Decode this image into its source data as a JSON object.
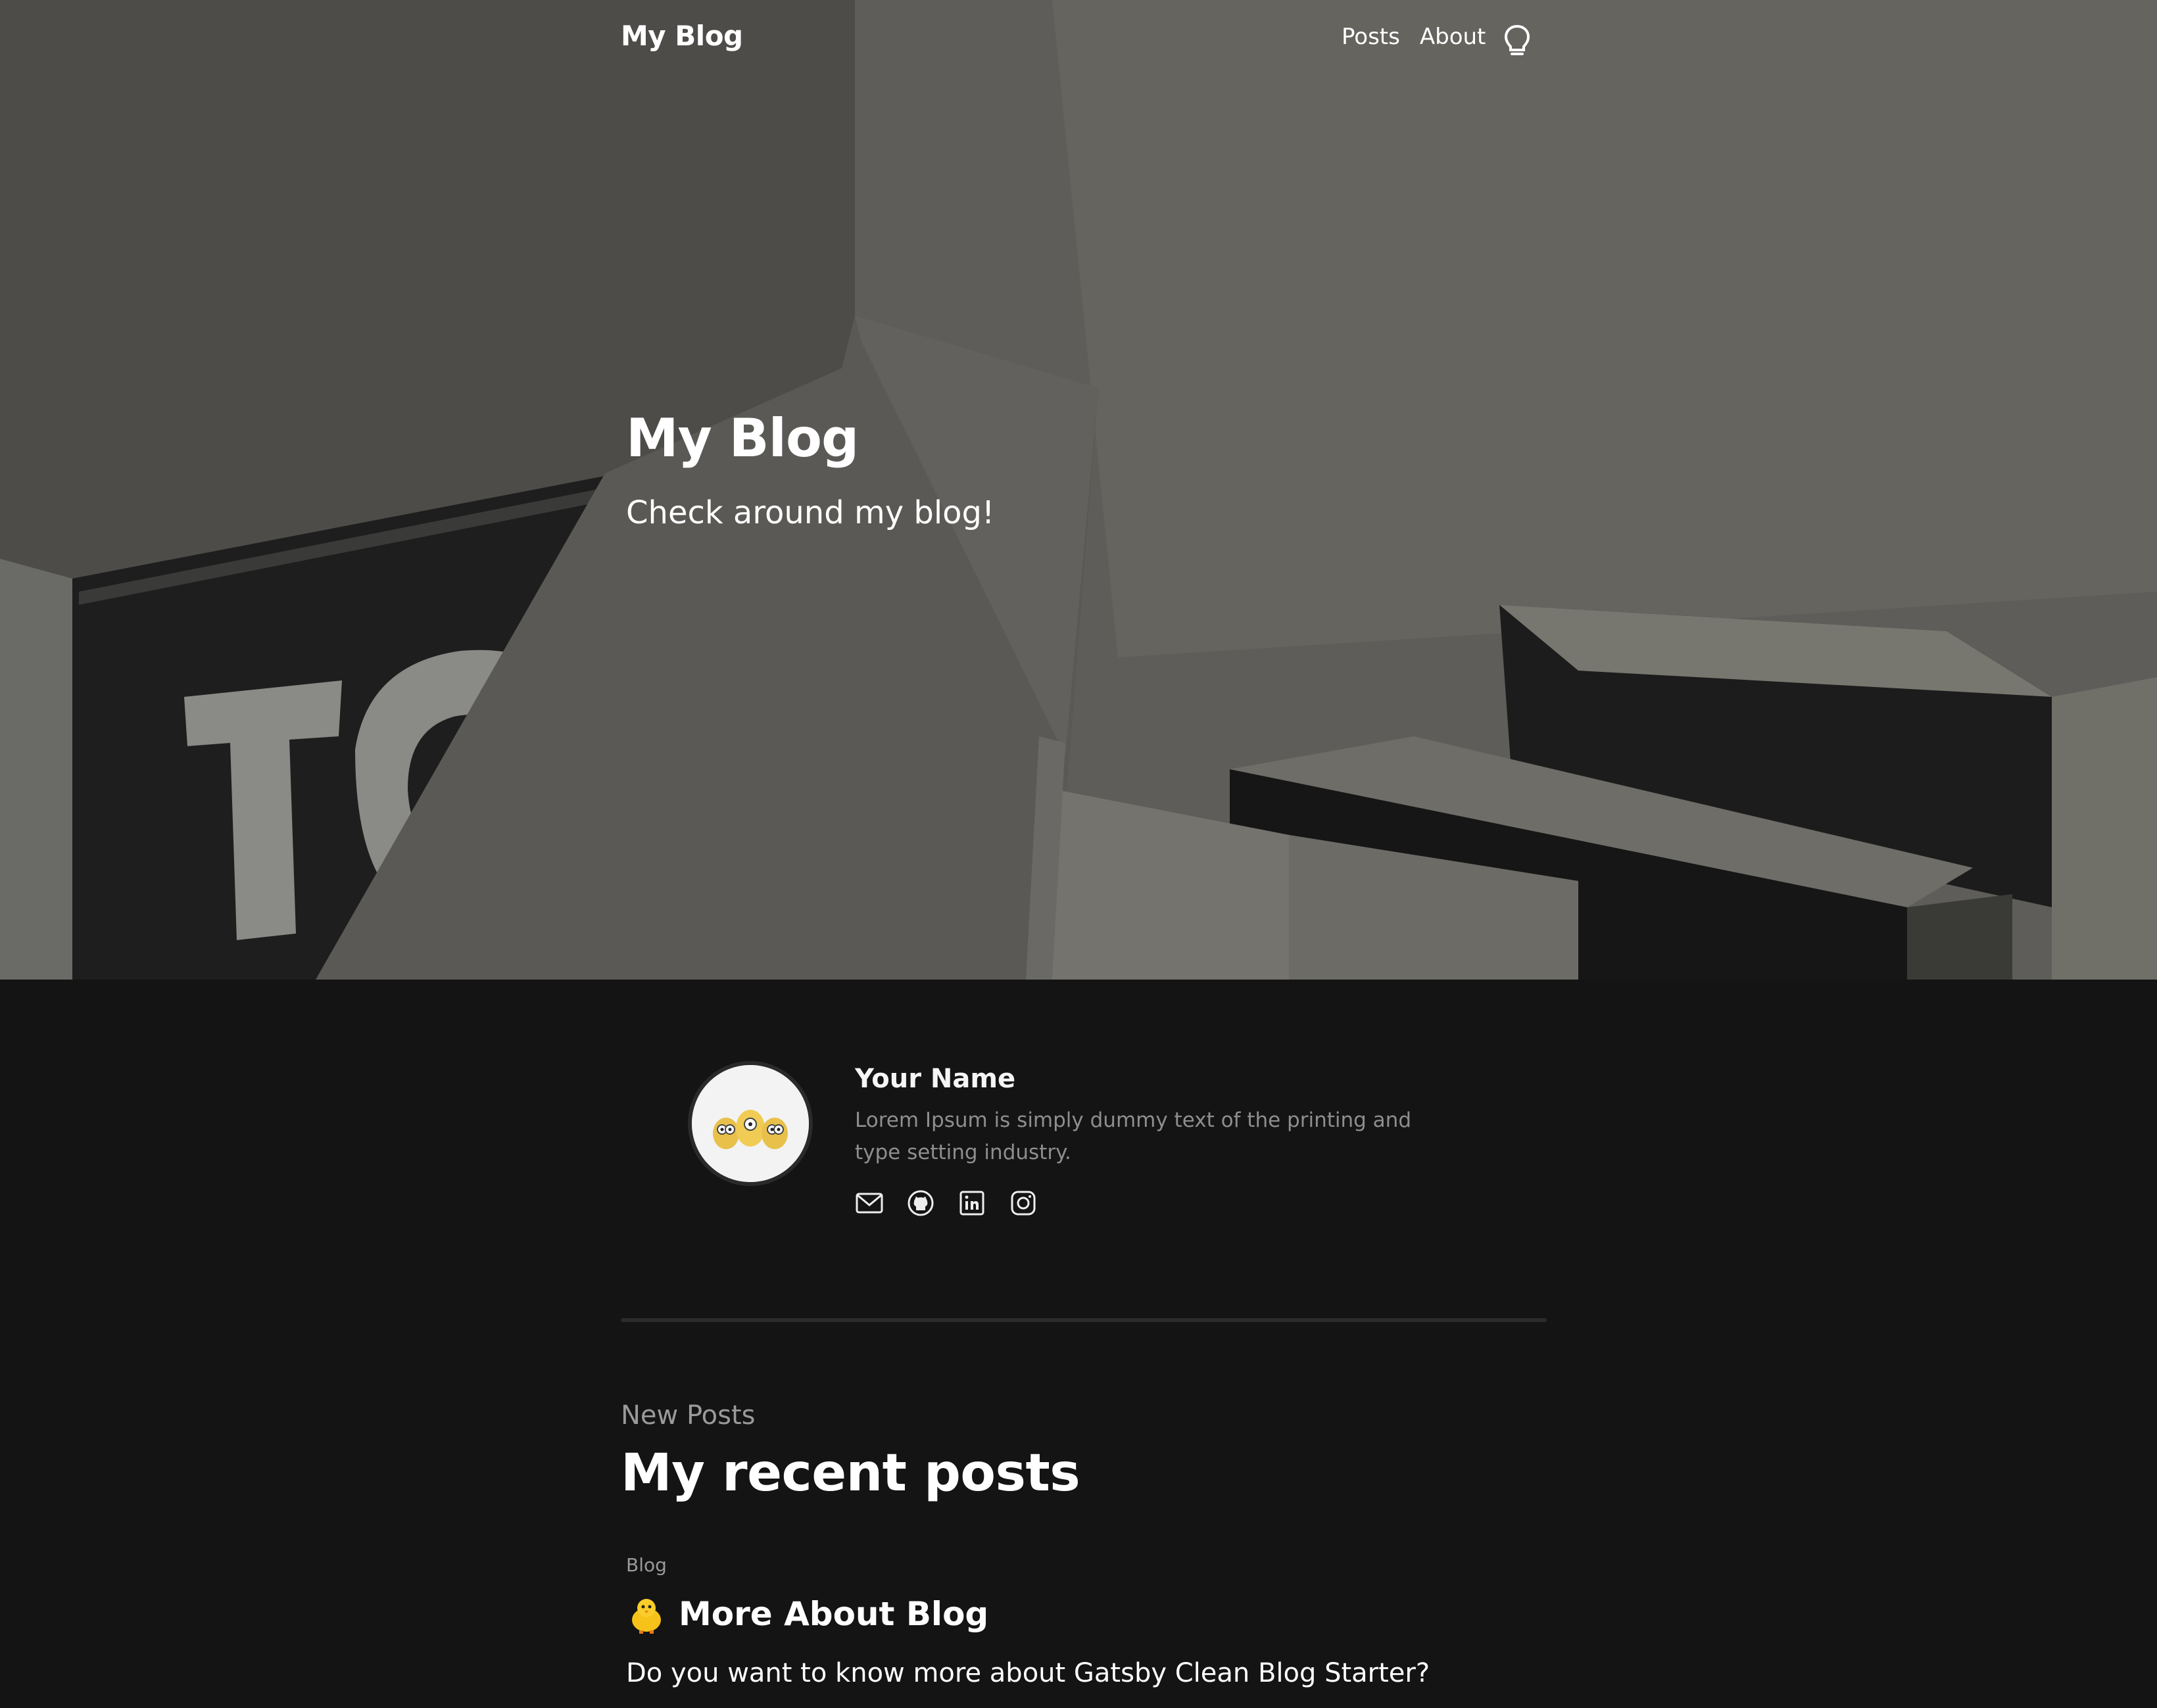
{
  "header": {
    "brand": "My Blog",
    "nav": [
      {
        "label": "Posts"
      },
      {
        "label": "About"
      }
    ],
    "theme_icon": "lightbulb-icon"
  },
  "hero": {
    "title": "My Blog",
    "subtitle": "Check around my blog!"
  },
  "bio": {
    "name": "Your Name",
    "description": "Lorem Ipsum is simply dummy text of the printing and type setting industry.",
    "socials": [
      {
        "icon": "mail-icon"
      },
      {
        "icon": "github-icon"
      },
      {
        "icon": "linkedin-icon"
      },
      {
        "icon": "instagram-icon"
      }
    ]
  },
  "posts": {
    "label": "New Posts",
    "title": "My recent posts",
    "items": [
      {
        "category": "Blog",
        "emoji": "🐥",
        "title": "More About Blog",
        "excerpt": "Do you want to know more about Gatsby Clean Blog Starter?"
      }
    ]
  },
  "colors": {
    "page_bg": "#141414",
    "muted_text": "#8e8e8e",
    "divider": "#2b2b2b"
  }
}
